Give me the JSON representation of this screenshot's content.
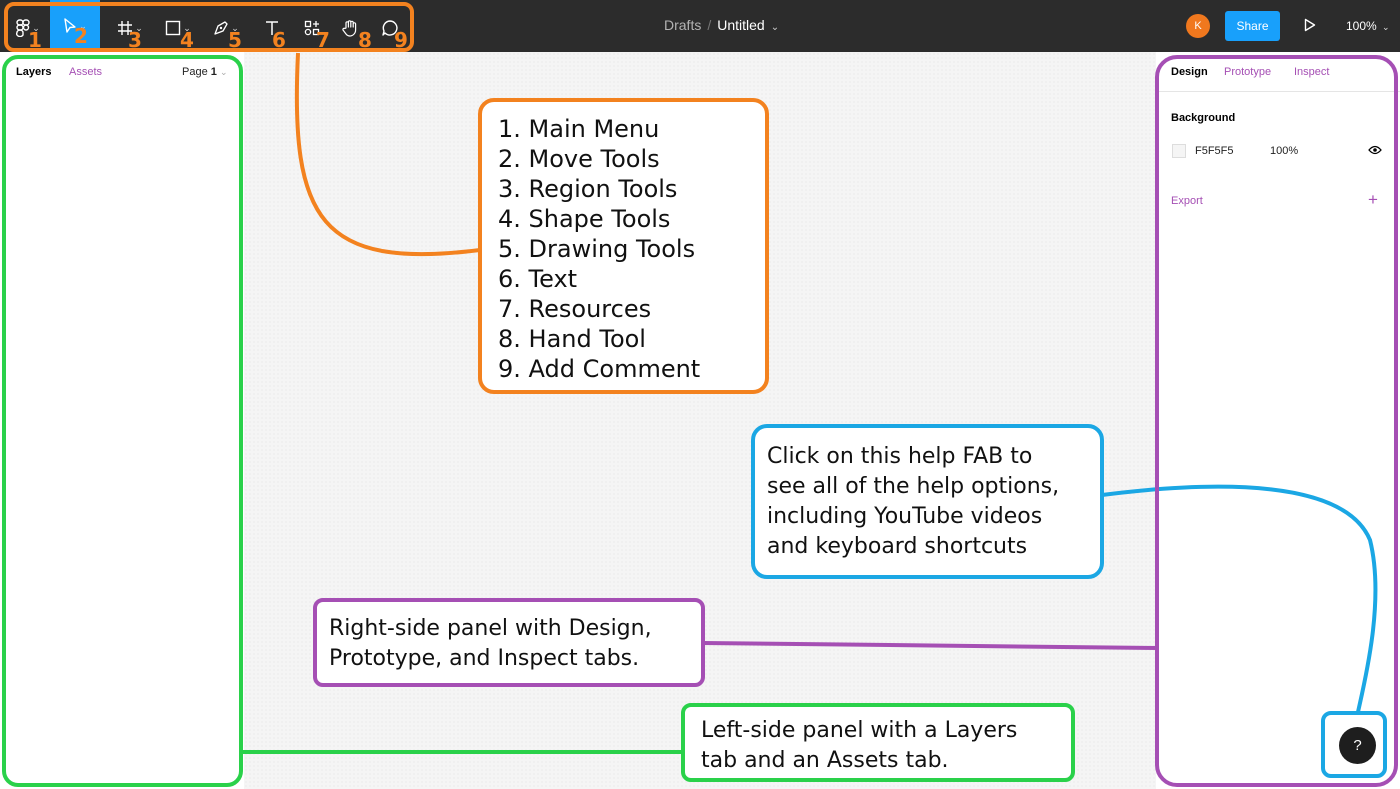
{
  "toolbar": {
    "tools": [
      {
        "num": "1",
        "icon": "figma-menu-icon"
      },
      {
        "num": "2",
        "icon": "move-cursor-icon"
      },
      {
        "num": "3",
        "icon": "frame-hash-icon"
      },
      {
        "num": "4",
        "icon": "rectangle-icon"
      },
      {
        "num": "5",
        "icon": "pen-icon"
      },
      {
        "num": "6",
        "icon": "text-icon"
      },
      {
        "num": "7",
        "icon": "resources-icon"
      },
      {
        "num": "8",
        "icon": "hand-icon"
      },
      {
        "num": "9",
        "icon": "comment-icon"
      }
    ],
    "breadcrumb_drafts": "Drafts",
    "breadcrumb_sep": "/",
    "file_name": "Untitled",
    "avatar_initial": "K",
    "share_label": "Share",
    "zoom": "100%"
  },
  "left_panel": {
    "tab_layers": "Layers",
    "tab_assets": "Assets",
    "page_label": "Page",
    "page_number": "1"
  },
  "right_panel": {
    "tab_design": "Design",
    "tab_prototype": "Prototype",
    "tab_inspect": "Inspect",
    "background_heading": "Background",
    "background_hex": "F5F5F5",
    "background_opacity": "100%",
    "export_label": "Export",
    "export_add": "+"
  },
  "annotations": {
    "tool_list": [
      "1. Main Menu",
      "2. Move Tools",
      "3. Region Tools",
      "4. Shape Tools",
      "5. Drawing Tools",
      "6. Text",
      "7. Resources",
      "8. Hand Tool",
      "9. Add Comment"
    ],
    "help_note": [
      "Click on this help FAB to",
      "see all of the help options,",
      "including YouTube videos",
      "and keyboard shortcuts"
    ],
    "right_note": [
      "Right-side panel with Design,",
      "Prototype, and Inspect tabs."
    ],
    "left_note": [
      "Left-side panel with a Layers",
      "tab and an Assets tab."
    ]
  },
  "help_fab": "?",
  "colors": {
    "toolbar_bg": "#2c2c2c",
    "accent_blue": "#18a0fb",
    "annotation_orange": "#f3821f",
    "annotation_green": "#2ad14a",
    "annotation_blue": "#1ba7e4",
    "annotation_purple": "#a54fb4"
  }
}
